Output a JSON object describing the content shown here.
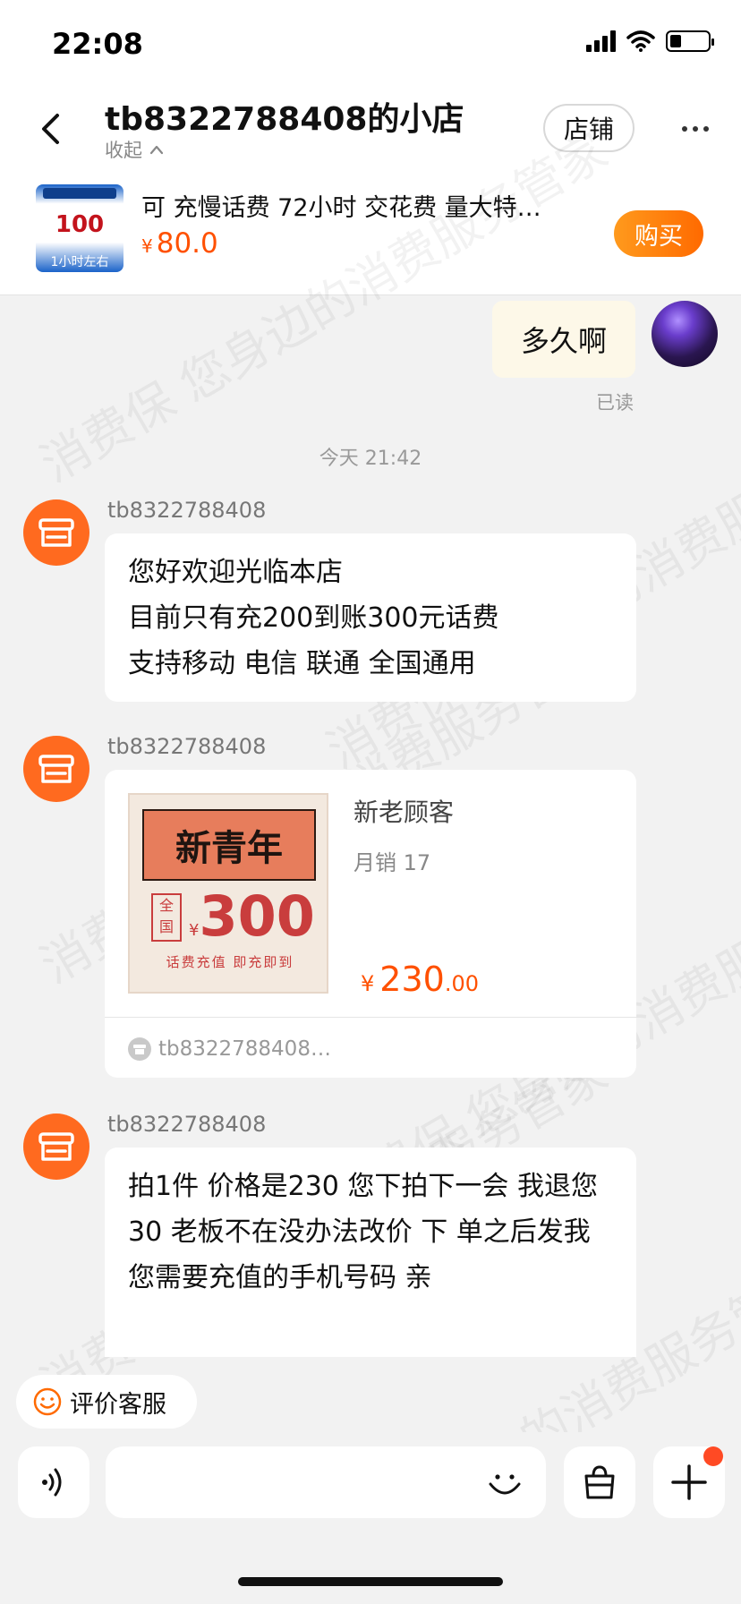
{
  "status_bar": {
    "time": "22:08"
  },
  "header": {
    "shop_name": "tb8322788408的小店",
    "collapse_label": "收起",
    "store_button": "店铺"
  },
  "product_bar": {
    "thumb_amount": "100",
    "thumb_caption": "1小时左右",
    "title": "可 充慢话费 72小时 交花费 量大特…",
    "price_symbol": "¥",
    "price": "80.0",
    "buy_button": "购买"
  },
  "messages": {
    "outgoing": {
      "text": "多久啊",
      "status": "已读"
    },
    "time_separator": "今天 21:42",
    "msg1": {
      "sender": "tb8322788408",
      "lines": [
        "您好欢迎光临本店",
        "目前只有充200到账300元话费",
        "支持移动 电信 联通 全国通用"
      ]
    },
    "msg2": {
      "sender": "tb8322788408",
      "card": {
        "image_title": "新青年",
        "image_region": "全国",
        "image_symbol": "¥",
        "image_amount": "300",
        "image_caption": "话费充值 即充即到",
        "name": "新老顾客",
        "sales": "月销 17",
        "price_symbol": "¥",
        "price_int": "230",
        "price_dec": ".00",
        "shop": "tb8322788408…"
      }
    },
    "msg3": {
      "sender": "tb8322788408",
      "lines": [
        "拍1件 价格是230 您下拍下一会",
        "我退您30 老板不在没办法改价 下",
        "单之后发我您需要充值的手机号码",
        "亲"
      ]
    }
  },
  "bottom": {
    "rate_button": "评价客服",
    "input_placeholder": ""
  },
  "watermark_text": "消费保 您身边的消费服务管家",
  "colors": {
    "accent_orange": "#ff5000",
    "shop_avatar": "#ff6a1f",
    "buy_gradient_start": "#ff9a1d",
    "buy_gradient_end": "#ff6a00",
    "outgoing_bubble": "#fdf8e8"
  }
}
